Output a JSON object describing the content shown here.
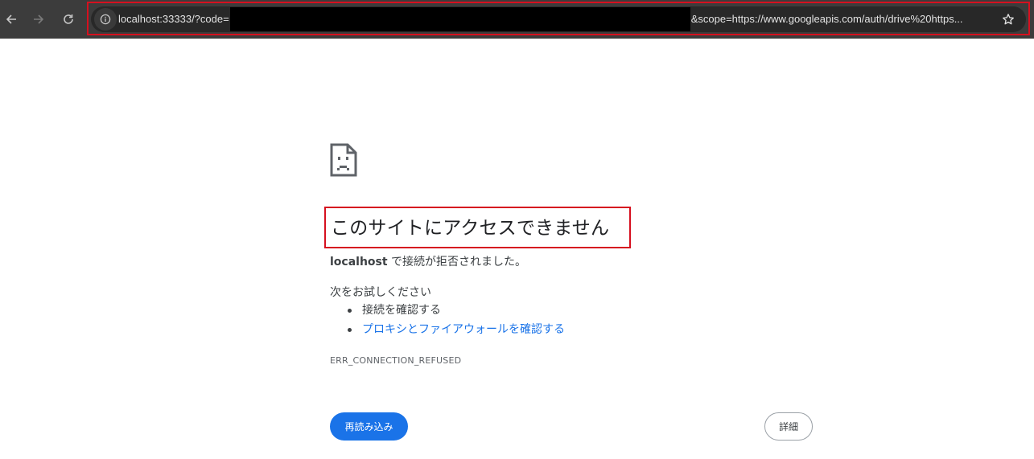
{
  "browser": {
    "url_prefix": "localhost:33333/?code=",
    "url_suffix": "&scope=https://www.googleapis.com/auth/drive%20https...",
    "icons": {
      "back": "arrow-left-icon",
      "forward": "arrow-right-icon",
      "reload": "reload-icon",
      "site_info": "info-icon",
      "bookmark": "star-icon"
    }
  },
  "error_page": {
    "icon": "sad-document-icon",
    "heading": "このサイトにアクセスできません",
    "host": "localhost",
    "summary_rest": " で接続が拒否されました。",
    "suggestions_title": "次をお試しください",
    "suggestions": [
      {
        "text": "接続を確認する",
        "link": false
      },
      {
        "text": "プロキシとファイアウォールを確認する",
        "link": true
      }
    ],
    "error_code": "ERR_CONNECTION_REFUSED",
    "reload_label": "再読み込み",
    "details_label": "詳細"
  },
  "colors": {
    "toolbar_bg": "#3c3c3c",
    "omnibox_bg": "#282828",
    "highlight": "#d6101f",
    "primary_button": "#1a73e8",
    "link": "#1a73e8"
  }
}
